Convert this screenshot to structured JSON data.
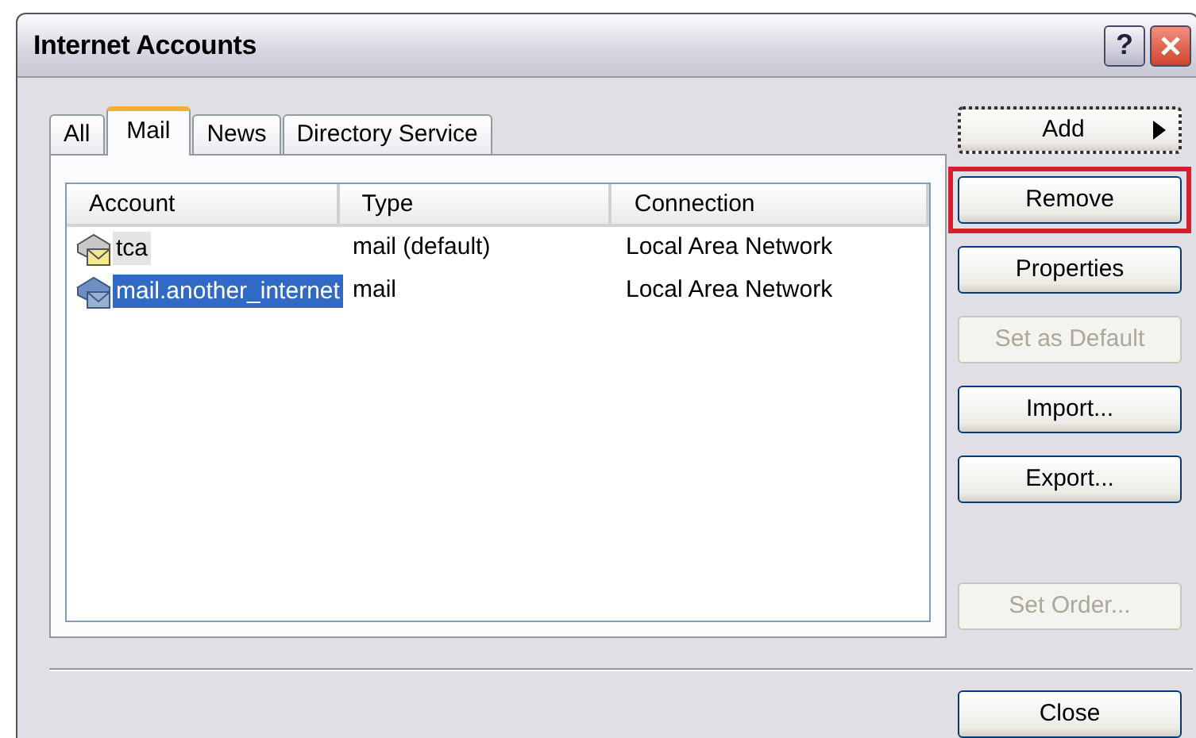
{
  "window": {
    "title": "Internet Accounts",
    "title_buttons": [
      {
        "kind": "help",
        "label": "?"
      },
      {
        "kind": "close"
      }
    ]
  },
  "tabs": [
    {
      "label": "All",
      "selected": false
    },
    {
      "label": "Mail",
      "selected": true
    },
    {
      "label": "News",
      "selected": false
    },
    {
      "label": "Directory Service",
      "selected": false
    }
  ],
  "table": {
    "columns": [
      "Account",
      "Type",
      "Connection"
    ],
    "rows": [
      {
        "account": "tca",
        "type": "mail (default)",
        "connection": "Local Area Network",
        "selected": false,
        "default": true
      },
      {
        "account": "mail.another_internet",
        "type": "mail",
        "connection": "Local Area Network",
        "selected": true,
        "default": false
      }
    ]
  },
  "buttons": [
    {
      "label": "Add",
      "kind": "menu",
      "disabled": false,
      "focused": true,
      "highlighted": false
    },
    {
      "label": "Remove",
      "kind": "push",
      "disabled": false,
      "focused": false,
      "highlighted": true
    },
    {
      "label": "Properties",
      "kind": "push",
      "disabled": false,
      "focused": false,
      "highlighted": false
    },
    {
      "label": "Set as Default",
      "kind": "push",
      "disabled": true,
      "focused": false,
      "highlighted": false
    },
    {
      "label": "Import...",
      "kind": "push",
      "disabled": false,
      "focused": false,
      "highlighted": false
    },
    {
      "label": "Export...",
      "kind": "push",
      "disabled": false,
      "focused": false,
      "highlighted": false
    },
    {
      "label": "Set Order...",
      "kind": "spacer-push",
      "disabled": true,
      "focused": false,
      "highlighted": false
    }
  ],
  "close_button": {
    "label": "Close"
  }
}
